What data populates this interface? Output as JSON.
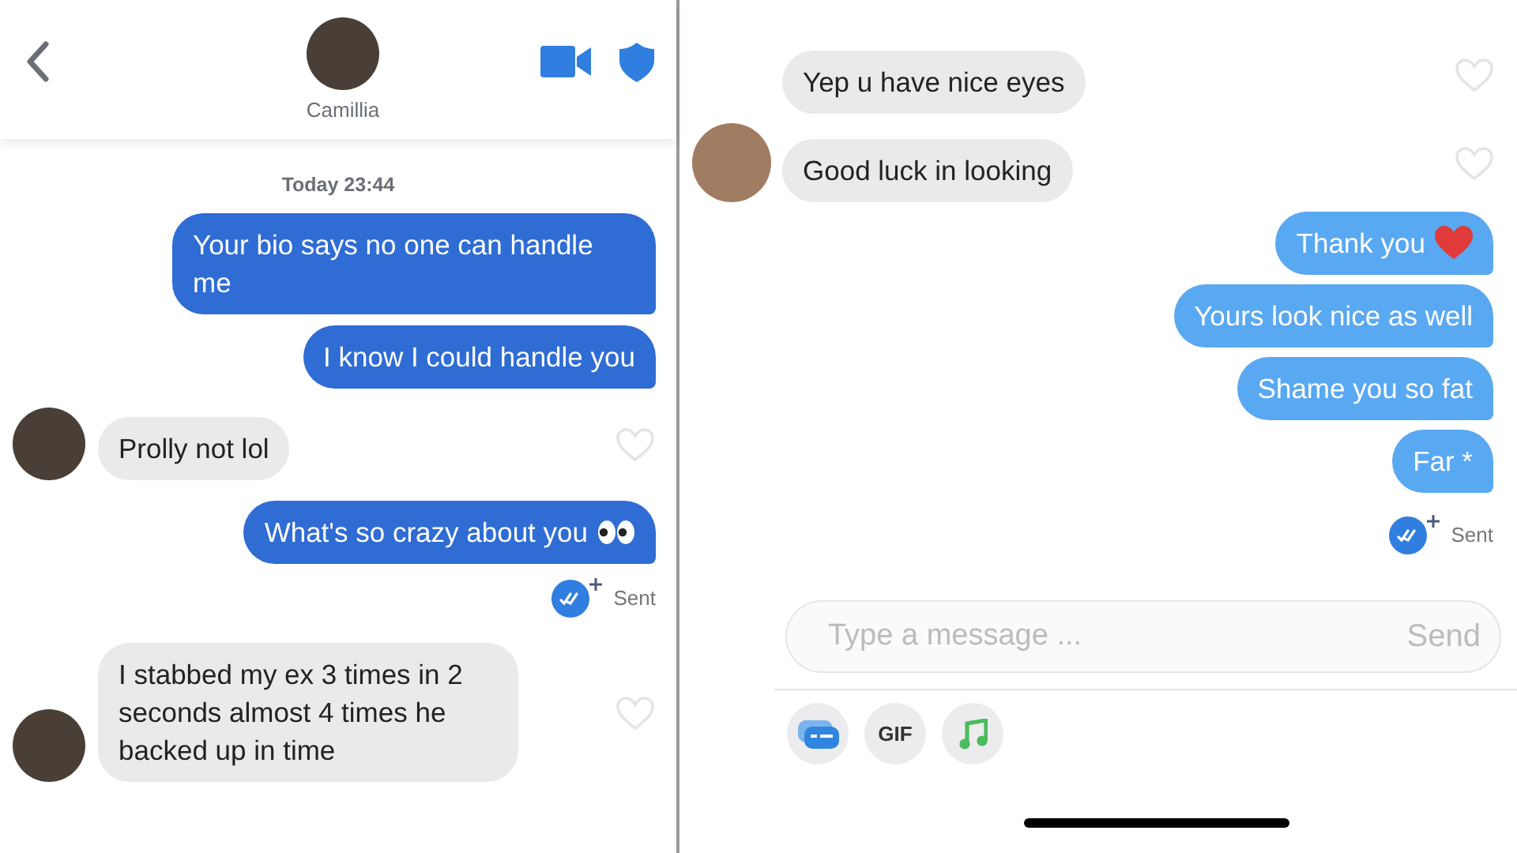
{
  "panels": [
    {
      "header": {
        "name": "Camillia"
      },
      "date_label": "Today 23:44",
      "messages": [
        {
          "kind": "sent",
          "text": "Your bio says no one can handle me"
        },
        {
          "kind": "sent",
          "text": "I know I could handle you"
        },
        {
          "kind": "received",
          "text": "Prolly not lol",
          "show_avatar": true,
          "liked": false
        },
        {
          "kind": "sent",
          "text": "What's so crazy about you",
          "trailing_emoji": {
            "kind": "eyes"
          }
        },
        {
          "kind": "receipt",
          "text": "Sent"
        },
        {
          "kind": "received",
          "text": "I stabbed my ex 3 times in 2 seconds almost 4 times he backed up in time",
          "show_avatar": true,
          "liked": false
        }
      ]
    },
    {
      "messages": [
        {
          "kind": "received",
          "text": "Yep u have nice eyes",
          "show_avatar": false,
          "liked": false
        },
        {
          "kind": "received",
          "text": "Good luck in looking",
          "show_avatar": true,
          "liked": false
        },
        {
          "kind": "sent",
          "text": "Thank you",
          "trailing_emoji": {
            "kind": "heart"
          }
        },
        {
          "kind": "sent",
          "text": "Yours look nice as well"
        },
        {
          "kind": "sent",
          "text": "Shame you so fat"
        },
        {
          "kind": "sent",
          "text": "Far *"
        },
        {
          "kind": "receipt",
          "text": "Sent"
        }
      ],
      "composer": {
        "placeholder": "Type a message ...",
        "send": "Send"
      },
      "attachments": [
        {
          "kind": "card"
        },
        {
          "kind": "gif",
          "label": "GIF"
        },
        {
          "kind": "music"
        }
      ]
    }
  ]
}
